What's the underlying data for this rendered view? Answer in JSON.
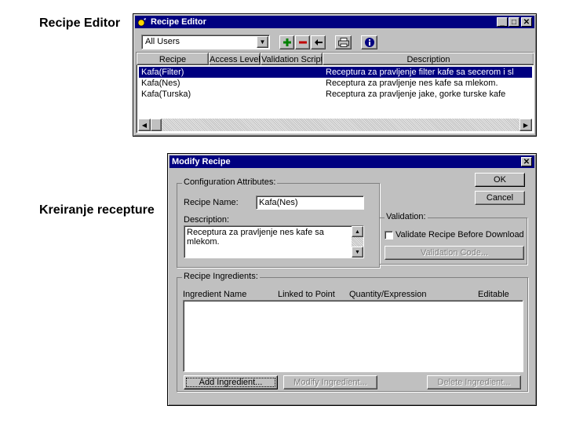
{
  "slide": {
    "label_editor": "Recipe Editor",
    "label_create": "Kreiranje recepture"
  },
  "editor": {
    "title": "Recipe Editor",
    "user_filter": "All Users",
    "columns": [
      "Recipe",
      "Access Level",
      "Validation Script",
      "Description"
    ],
    "rows": [
      {
        "recipe": "Kafa(Filter)",
        "description": "Receptura za pravljenje filter kafe sa secerom i sl"
      },
      {
        "recipe": "Kafa(Nes)",
        "description": "Receptura za pravljenje nes kafe sa mlekom."
      },
      {
        "recipe": "Kafa(Turska)",
        "description": "Receptura za pravljenje jake, gorke turske kafe"
      }
    ],
    "icons": {
      "add": "plus-icon",
      "remove": "minus-icon",
      "back": "arrow-left-icon",
      "print": "printer-icon",
      "info": "info-icon"
    },
    "accent": {
      "plus": "#008000",
      "minus": "#c00000",
      "info": "#000080"
    }
  },
  "modify": {
    "title": "Modify Recipe",
    "config_group": "Configuration Attributes:",
    "recipe_name_label": "Recipe Name:",
    "recipe_name_value": "Kafa(Nes)",
    "description_label": "Description:",
    "description_value": "Receptura za pravljenje nes kafe sa mlekom.",
    "ok": "OK",
    "cancel": "Cancel",
    "validation_group": "Validation:",
    "validate_label": "Validate Recipe Before Download",
    "validation_code": "Validation Code...",
    "ingredients_group": "Recipe Ingredients:",
    "ingredient_columns": [
      "Ingredient Name",
      "Linked to Point",
      "Quantity/Expression",
      "Editable"
    ],
    "add_ingredient": "Add Ingredient...",
    "modify_ingredient": "Modify Ingredient...",
    "delete_ingredient": "Delete Ingredient..."
  }
}
